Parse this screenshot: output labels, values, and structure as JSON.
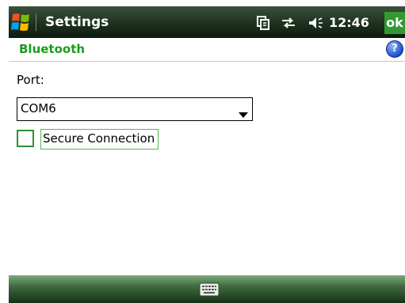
{
  "top_bar": {
    "title": "Settings",
    "time": "12:46",
    "ok_label": "ok",
    "icons": [
      "windows-start-icon",
      "connectivity-icon",
      "sync-icon",
      "volume-icon"
    ]
  },
  "header": {
    "title": "Bluetooth",
    "help_label": "?"
  },
  "form": {
    "port_label": "Port:",
    "port_value": "COM6",
    "secure_connection_label": "Secure Connection",
    "secure_connection_checked": false
  },
  "bottom_bar": {
    "icons": [
      "keyboard-icon"
    ]
  },
  "colors": {
    "accent_green": "#1a9d1a",
    "ok_green": "#339933",
    "checkbox_border": "#2f8f2f",
    "top_bar_dark": "#1e3120",
    "help_blue": "#1c4fcf"
  }
}
